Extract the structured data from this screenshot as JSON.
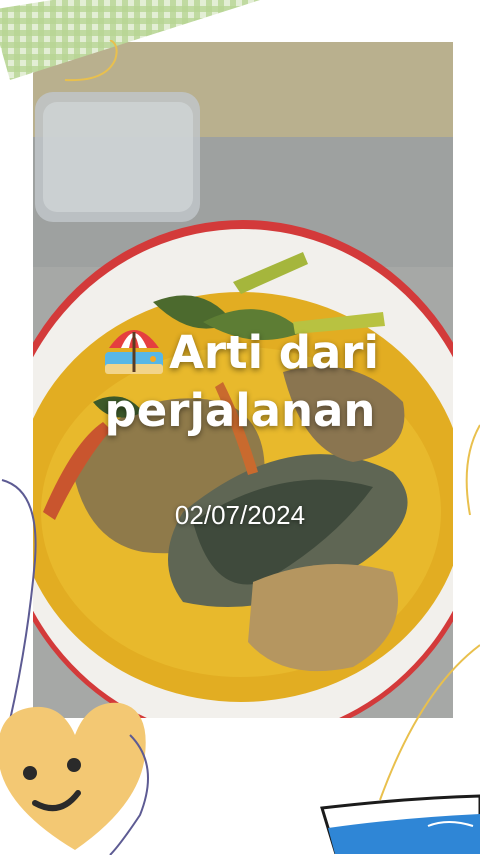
{
  "story": {
    "title_line1": "Arti dari",
    "title_line2": "perjalanan",
    "date": "02/07/2024"
  },
  "icons": {
    "title_emoji": "beach-umbrella-icon",
    "heart_sticker": "smiling-heart-icon",
    "water_glass": "water-glass-icon"
  },
  "colors": {
    "broth": "#e6b427",
    "bowl_rim": "#d23a3a",
    "tape_green": "#b9d596",
    "heart": "#f3c873",
    "water": "#2f86d6"
  }
}
